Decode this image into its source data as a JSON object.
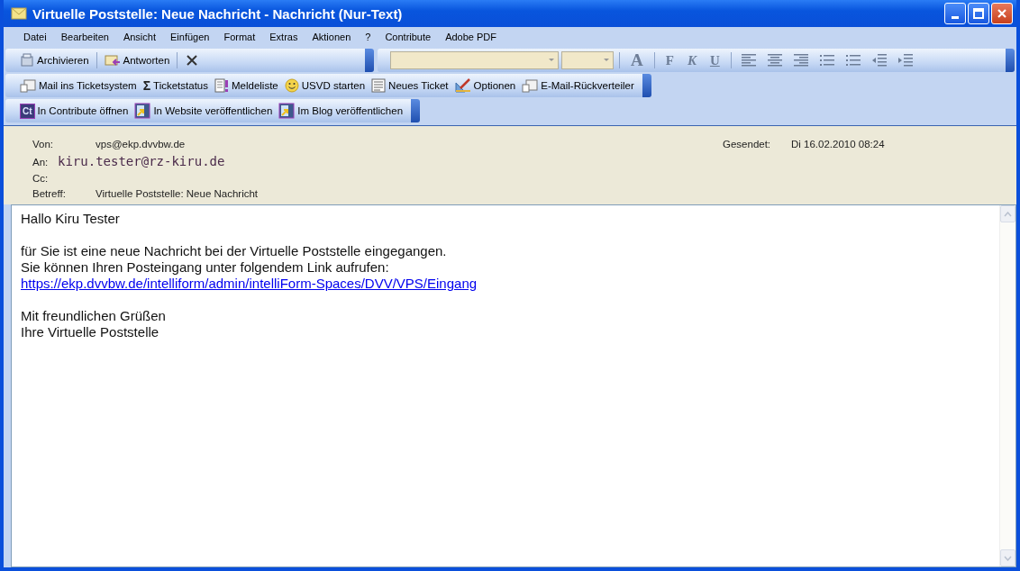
{
  "window": {
    "title": "Virtuelle Poststelle: Neue Nachricht - Nachricht (Nur-Text)"
  },
  "menu": [
    "Datei",
    "Bearbeiten",
    "Ansicht",
    "Einfügen",
    "Format",
    "Extras",
    "Aktionen",
    "?",
    "Contribute",
    "Adobe PDF"
  ],
  "standard_toolbar": {
    "buttons": [
      "Archivieren",
      "Antworten"
    ]
  },
  "format_toolbar": {
    "font_color": "A",
    "styles": [
      "F",
      "K",
      "U"
    ]
  },
  "ticket_toolbar": {
    "buttons": [
      "Mail ins Ticketsystem",
      "Ticketstatus",
      "Meldeliste",
      "USVD starten",
      "Neues Ticket",
      "Optionen",
      "E-Mail-Rückverteiler"
    ],
    "sigma": "Σ"
  },
  "contribute_toolbar": {
    "buttons": [
      "In Contribute öffnen",
      "In Website veröffentlichen",
      "Im Blog veröffentlichen"
    ],
    "logo": "Ct"
  },
  "header": {
    "from_label": "Von:",
    "from": "vps@ekp.dvvbw.de",
    "sent_label": "Gesendet:",
    "sent": "Di 16.02.2010 08:24",
    "to_label": "An:",
    "to": "kiru.tester@rz-kiru.de",
    "cc_label": "Cc:",
    "subject_label": "Betreff:",
    "subject": "Virtuelle Poststelle: Neue Nachricht"
  },
  "body": {
    "greeting": "Hallo Kiru Tester",
    "lines": [
      "für Sie ist eine neue Nachricht bei der Virtuelle Poststelle eingegangen.",
      "Sie können Ihren Posteingang unter folgendem Link aufrufen:"
    ],
    "link": "https://ekp.dvvbw.de/intelliform/admin/intelliForm-Spaces/DVV/VPS/Eingang",
    "closing": [
      "Mit freundlichen Grüßen",
      "Ihre Virtuelle Poststelle"
    ]
  }
}
